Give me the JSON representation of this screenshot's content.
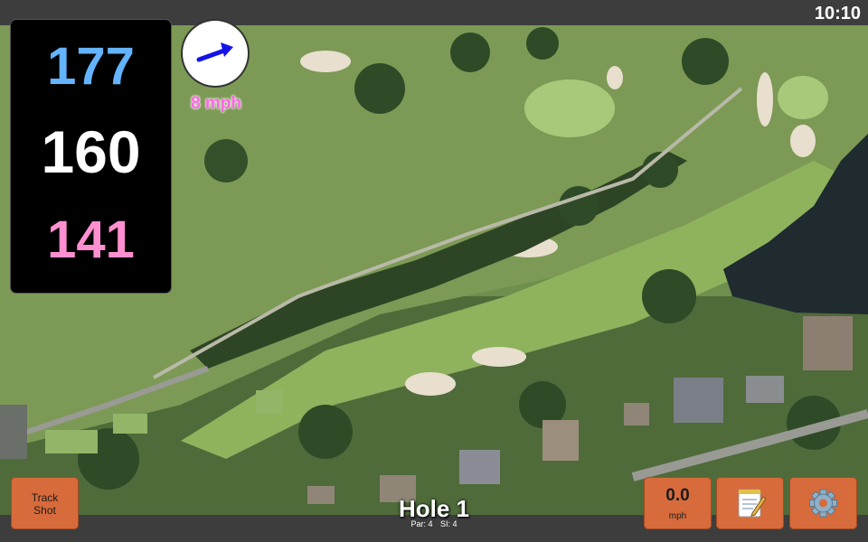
{
  "status_bar": {
    "time": "10:10"
  },
  "yardages": {
    "back": "177",
    "center": "160",
    "front": "141"
  },
  "wind": {
    "speed_label": "8 mph",
    "icon": "wind-arrow-icon"
  },
  "hole": {
    "title": "Hole 1",
    "par": "Par: 4",
    "si": "SI: 4"
  },
  "buttons": {
    "track_shot_line1": "Track",
    "track_shot_line2": "Shot",
    "speed_value": "0.0",
    "speed_unit": "mph",
    "notes_icon": "notepad-icon",
    "settings_icon": "gear-icon"
  },
  "colors": {
    "back_yardage": "#63b3ff",
    "center_yardage": "#ffffff",
    "front_yardage": "#ff8fd0",
    "wind_text": "#ff66e6",
    "button": "#d86b3b"
  }
}
